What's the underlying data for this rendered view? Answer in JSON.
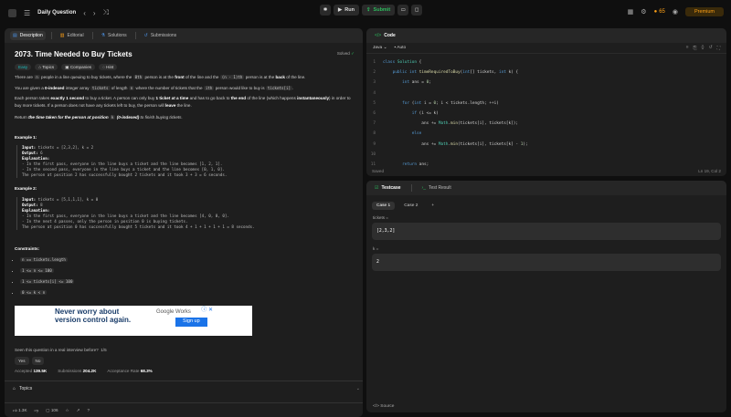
{
  "topbar": {
    "title": "Daily Question",
    "run_label": "Run",
    "submit_label": "Submit",
    "streak": "65",
    "premium_label": "Premium"
  },
  "tabs": [
    {
      "label": "Description"
    },
    {
      "label": "Editorial"
    },
    {
      "label": "Solutions"
    },
    {
      "label": "Submissions"
    }
  ],
  "problem": {
    "title": "2073. Time Needed to Buy Tickets",
    "status": "Solved",
    "difficulty": "Easy",
    "tag_topics": "Topics",
    "tag_companies": "Companies",
    "tag_hint": "Hint",
    "p1a": "There are",
    "p1b": "n",
    "p1c": "people in a line queuing to buy tickets, where the",
    "p1d": "0th",
    "p1e": "person is at the",
    "p1f": "front",
    "p1g": "of the line and the",
    "p1h": "(n - 1)th",
    "p1i": "person is at the",
    "p1j": "back",
    "p1k": "of the line.",
    "p2a": "You are given a",
    "p2b": "0-indexed",
    "p2c": "integer array",
    "p2d": "tickets",
    "p2e": "of length",
    "p2f": "n",
    "p2g": "where the number of tickets that the",
    "p2h": "ith",
    "p2i": "person would like to buy is",
    "p2j": "tickets[i]",
    "p2k": ".",
    "p3a": "Each person takes",
    "p3b": "exactly 1 second",
    "p3c": "to buy a ticket. A person can only buy",
    "p3d": "1 ticket at a time",
    "p3e": "and has to go back to",
    "p3f": "the end",
    "p3g": "of the line (which happens",
    "p3h": "instantaneously",
    "p3i": ") in order to buy more tickets. If a person does not have any tickets left to buy, the person will",
    "p3j": "leave",
    "p3k": "the line.",
    "p4a": "Return",
    "p4b": "the time taken for the person at position",
    "p4c": "k",
    "p4d": "(0-indexed)",
    "p4e": "to finish buying tickets.",
    "ex1_title": "Example 1:",
    "ex1": [
      {
        "k": "Input:",
        "v": " tickets = [2,3,2], k = 2"
      },
      {
        "k": "Output:",
        "v": " 6"
      },
      {
        "k": "Explanation:",
        "v": ""
      },
      {
        "k": "",
        "v": "- In the first pass, everyone in the line buys a ticket and the line becomes [1, 2, 1]."
      },
      {
        "k": "",
        "v": "- In the second pass, everyone in the line buys a ticket and the line becomes [0, 1, 0]."
      },
      {
        "k": "",
        "v": "The person at position 2 has successfully bought 2 tickets and it took 3 + 3 = 6 seconds."
      }
    ],
    "ex2_title": "Example 2:",
    "ex2": [
      {
        "k": "Input:",
        "v": " tickets = [5,1,1,1], k = 0"
      },
      {
        "k": "Output:",
        "v": " 8"
      },
      {
        "k": "Explanation:",
        "v": ""
      },
      {
        "k": "",
        "v": "- In the first pass, everyone in the line buys a ticket and the line becomes [4, 0, 0, 0]."
      },
      {
        "k": "",
        "v": "- In the next 4 passes, only the person in position 0 is buying tickets."
      },
      {
        "k": "",
        "v": "The person at position 0 has successfully bought 5 tickets and it took 4 + 1 + 1 + 1 + 1 = 8 seconds."
      }
    ],
    "constraints_title": "Constraints:",
    "constraints": [
      "n == tickets.length",
      "1 <= n <= 100",
      "1 <= tickets[i] <= 100",
      "0 <= k < n"
    ]
  },
  "ad": {
    "line1": "Never worry about",
    "line2": "version control again.",
    "brand": "Google Works",
    "button": "Sign up",
    "close": "ⓘ ✕"
  },
  "meta": {
    "seen": "Seen this question in a real interview before?",
    "seen_count": "1/5",
    "yes": "Yes",
    "no": "No",
    "accepted_label": "Accepted",
    "accepted_value": "139.5K",
    "submissions_label": "Submissions",
    "submissions_value": "204.2K",
    "rate_label": "Acceptance Rate",
    "rate_value": "68.3%",
    "topics": "Topics",
    "likes": "1.3K",
    "comments": "106"
  },
  "code": {
    "header": "Code",
    "language": "Java",
    "mode": "Auto",
    "saved": "Saved",
    "position": "Ln 19, Col 2",
    "lines": [
      {
        "n": "1",
        "t": "class Solution {"
      },
      {
        "n": "2",
        "t": "    public int timeRequiredToBuy(int[] tickets, int k) {"
      },
      {
        "n": "3",
        "t": "        int ans = 0;"
      },
      {
        "n": "4",
        "t": ""
      },
      {
        "n": "5",
        "t": "        for (int i = 0; i < tickets.length; ++i)"
      },
      {
        "n": "6",
        "t": "            if (i <= k)"
      },
      {
        "n": "7",
        "t": "                ans += Math.min(tickets[i], tickets[k]);"
      },
      {
        "n": "8",
        "t": "            else"
      },
      {
        "n": "9",
        "t": "                ans += Math.min(tickets[i], tickets[k] - 1);"
      },
      {
        "n": "10",
        "t": ""
      },
      {
        "n": "11",
        "t": "        return ans;"
      }
    ]
  },
  "testcase": {
    "tab1": "Testcase",
    "tab2": "Test Result",
    "case1": "Case 1",
    "case2": "Case 2",
    "add": "+",
    "label1": "tickets =",
    "value1": "[2,3,2]",
    "label2": "k =",
    "value2": "2",
    "source": "Source"
  }
}
